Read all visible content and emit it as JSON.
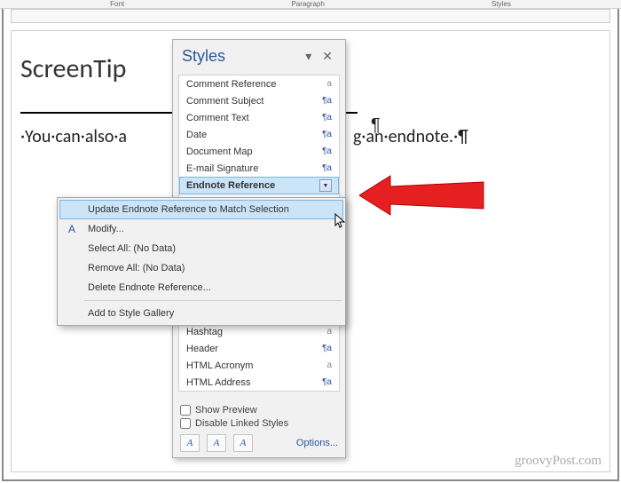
{
  "ribbon_fragments": [
    "Font",
    "Paragraph",
    "Styles"
  ],
  "doc": {
    "title_text": "ScreenTip",
    "body_prefix": "·You·can·also·a",
    "body_suffix": "g·an·endnote.·¶",
    "paragraph_mark": "¶"
  },
  "styles_pane": {
    "title": "Styles",
    "list_top": [
      {
        "label": "Comment Reference",
        "icon": "a",
        "type": "char"
      },
      {
        "label": "Comment Subject",
        "icon": "¶a",
        "type": "linked"
      },
      {
        "label": "Comment Text",
        "icon": "¶a",
        "type": "linked"
      },
      {
        "label": "Date",
        "icon": "¶a",
        "type": "linked"
      },
      {
        "label": "Document Map",
        "icon": "¶a",
        "type": "linked"
      },
      {
        "label": "E-mail Signature",
        "icon": "¶a",
        "type": "linked"
      }
    ],
    "selected": {
      "label": "Endnote Reference",
      "icon": "a"
    },
    "list_bottom": [
      {
        "label": "Hashtag",
        "icon": "a",
        "type": "char"
      },
      {
        "label": "Header",
        "icon": "¶a",
        "type": "linked"
      },
      {
        "label": "HTML Acronym",
        "icon": "a",
        "type": "char"
      },
      {
        "label": "HTML Address",
        "icon": "¶a",
        "type": "linked"
      }
    ],
    "show_preview": "Show Preview",
    "disable_linked": "Disable Linked Styles",
    "options_link": "Options..."
  },
  "context_menu": {
    "items": [
      {
        "label": "Update Endnote Reference to Match Selection",
        "highlighted": true
      },
      {
        "label": "Modify...",
        "icon": "A"
      },
      {
        "label": "Select All: (No Data)"
      },
      {
        "label": "Remove All: (No Data)"
      },
      {
        "label": "Delete Endnote Reference..."
      },
      {
        "label": "Add to Style Gallery"
      }
    ]
  },
  "watermark": "groovyPost.com"
}
